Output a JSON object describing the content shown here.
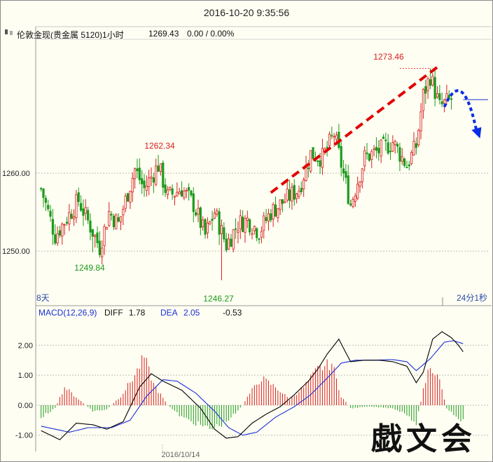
{
  "header": {
    "datetime": "2016-10-20 9:35:56",
    "instrument_icon": "candlestick-icon",
    "instrument": "伦敦金现(贵金属 5120)1小时",
    "last_price": "1269.43",
    "change": "0.00 / 0.00%"
  },
  "price_panel": {
    "left_label": "8天",
    "right_label": "24分1秒",
    "ann_high": "1273.46",
    "ann_peak_left": "1262.34",
    "ann_low_left": "1249.84",
    "ann_low": "1246.27"
  },
  "macd_panel": {
    "label": "MACD(12,26,9)",
    "diff_label": "DIFF",
    "diff_value": "1.78",
    "dea_label": "DEA",
    "dea_value": "2.05",
    "macd_value": "-0.53",
    "date_label": "2016/10/14"
  },
  "signature": "戯文会",
  "colors": {
    "up": "#d81e1e",
    "down": "#1c9a1c",
    "diff": "#000000",
    "dea": "#1a2fd6",
    "trend": "#e00000",
    "forecast": "#0a2ee8"
  },
  "chart_data": [
    {
      "type": "candlestick",
      "y_ticks": [
        1250.0,
        1260.0
      ],
      "y_tick_labels": [
        "1250.00",
        "1260.00"
      ],
      "ylim": [
        1243.0,
        1277.0
      ],
      "grid": true,
      "bars": 120,
      "key_points": [
        {
          "bar": 0,
          "price": 1258.0
        },
        {
          "bar": 6,
          "price": 1252.0
        },
        {
          "bar": 16,
          "price": 1256.5
        },
        {
          "bar": 25,
          "price": 1250.5
        },
        {
          "bar": 29,
          "price": 1255.0
        },
        {
          "bar": 33,
          "price": 1253.5
        },
        {
          "bar": 40,
          "price": 1260.5
        },
        {
          "bar": 44,
          "price": 1258.0
        },
        {
          "bar": 50,
          "price": 1261.0
        },
        {
          "bar": 54,
          "price": 1257.0
        },
        {
          "bar": 60,
          "price": 1258.0
        },
        {
          "bar": 65,
          "price": 1256.0
        },
        {
          "bar": 70,
          "price": 1252.0
        },
        {
          "bar": 74,
          "price": 1255.0
        },
        {
          "bar": 79,
          "price": 1250.8
        },
        {
          "bar": 84,
          "price": 1253.5
        },
        {
          "bar": 88,
          "price": 1254.0
        },
        {
          "bar": 93,
          "price": 1252.5
        },
        {
          "bar": 98,
          "price": 1255.0
        },
        {
          "bar": 104,
          "price": 1256.5
        },
        {
          "bar": 110,
          "price": 1258.0
        },
        {
          "bar": 115,
          "price": 1262.5
        },
        {
          "bar": 120,
          "price": 1262.0
        },
        {
          "bar": 125,
          "price": 1265.0
        },
        {
          "bar": 132,
          "price": 1256.0
        },
        {
          "bar": 138,
          "price": 1262.0
        },
        {
          "bar": 145,
          "price": 1263.0
        },
        {
          "bar": 150,
          "price": 1264.0
        },
        {
          "bar": 156,
          "price": 1261.0
        },
        {
          "bar": 160,
          "price": 1263.5
        },
        {
          "bar": 163,
          "price": 1270.0
        },
        {
          "bar": 166,
          "price": 1272.5
        },
        {
          "bar": 170,
          "price": 1268.5
        },
        {
          "bar": 175,
          "price": 1269.5
        }
      ],
      "highlights": [
        {
          "label": "1273.46",
          "bar": 166,
          "price": 1273.46
        },
        {
          "label": "1262.34",
          "bar": 50,
          "price": 1262.34
        },
        {
          "label": "1249.84",
          "bar": 22,
          "price": 1249.84
        },
        {
          "label": "1246.27",
          "bar": 77,
          "price": 1246.27
        }
      ]
    },
    {
      "type": "macd",
      "y_ticks": [
        -1.0,
        0.0,
        1.0,
        2.0
      ],
      "y_tick_labels": [
        "-1.00",
        "0.00",
        "1.00",
        "2.00"
      ],
      "ylim": [
        -1.45,
        2.85
      ],
      "diff_end": 1.78,
      "dea_end": 2.05,
      "macd_end": -0.53,
      "diff_key": [
        [
          0,
          -0.85
        ],
        [
          8,
          -1.15
        ],
        [
          15,
          -0.6
        ],
        [
          22,
          -0.65
        ],
        [
          28,
          -0.8
        ],
        [
          35,
          -0.55
        ],
        [
          42,
          0.6
        ],
        [
          47,
          1.05
        ],
        [
          52,
          0.8
        ],
        [
          60,
          0.5
        ],
        [
          68,
          -0.1
        ],
        [
          74,
          -0.8
        ],
        [
          79,
          -1.1
        ],
        [
          84,
          -1.05
        ],
        [
          90,
          -0.6
        ],
        [
          96,
          -0.3
        ],
        [
          102,
          -0.05
        ],
        [
          108,
          0.35
        ],
        [
          114,
          0.8
        ],
        [
          118,
          1.2
        ],
        [
          122,
          1.7
        ],
        [
          127,
          2.2
        ],
        [
          132,
          1.45
        ],
        [
          138,
          1.5
        ],
        [
          144,
          1.5
        ],
        [
          150,
          1.45
        ],
        [
          156,
          1.3
        ],
        [
          160,
          0.75
        ],
        [
          163,
          1.1
        ],
        [
          167,
          2.2
        ],
        [
          171,
          2.45
        ],
        [
          175,
          2.25
        ],
        [
          178,
          2.0
        ],
        [
          180,
          1.78
        ]
      ],
      "dea_key": [
        [
          0,
          -0.7
        ],
        [
          12,
          -0.9
        ],
        [
          20,
          -0.75
        ],
        [
          30,
          -0.75
        ],
        [
          38,
          -0.5
        ],
        [
          45,
          0.3
        ],
        [
          52,
          0.85
        ],
        [
          58,
          0.8
        ],
        [
          66,
          0.4
        ],
        [
          74,
          -0.2
        ],
        [
          80,
          -0.75
        ],
        [
          86,
          -1.0
        ],
        [
          92,
          -0.9
        ],
        [
          100,
          -0.4
        ],
        [
          108,
          -0.05
        ],
        [
          115,
          0.35
        ],
        [
          122,
          0.9
        ],
        [
          128,
          1.4
        ],
        [
          134,
          1.5
        ],
        [
          142,
          1.5
        ],
        [
          150,
          1.52
        ],
        [
          156,
          1.45
        ],
        [
          160,
          1.15
        ],
        [
          166,
          1.55
        ],
        [
          172,
          2.1
        ],
        [
          176,
          2.15
        ],
        [
          180,
          2.05
        ]
      ],
      "hist_key": [
        [
          0,
          -0.4
        ],
        [
          6,
          -0.1
        ],
        [
          10,
          0.6
        ],
        [
          16,
          0.2
        ],
        [
          22,
          -0.2
        ],
        [
          28,
          -0.15
        ],
        [
          34,
          0.3
        ],
        [
          40,
          1.0
        ],
        [
          44,
          1.6
        ],
        [
          48,
          0.7
        ],
        [
          54,
          0.0
        ],
        [
          60,
          -0.4
        ],
        [
          66,
          -0.6
        ],
        [
          72,
          -0.8
        ],
        [
          78,
          -0.6
        ],
        [
          84,
          -0.2
        ],
        [
          90,
          0.5
        ],
        [
          94,
          0.9
        ],
        [
          100,
          0.6
        ],
        [
          106,
          0.2
        ],
        [
          112,
          0.6
        ],
        [
          118,
          1.2
        ],
        [
          124,
          1.4
        ],
        [
          128,
          0.3
        ],
        [
          132,
          -0.1
        ],
        [
          140,
          -0.05
        ],
        [
          150,
          -0.1
        ],
        [
          156,
          -0.3
        ],
        [
          160,
          -0.6
        ],
        [
          163,
          0.5
        ],
        [
          166,
          1.4
        ],
        [
          170,
          0.8
        ],
        [
          173,
          -0.1
        ],
        [
          176,
          -0.3
        ],
        [
          180,
          -0.53
        ]
      ]
    }
  ]
}
